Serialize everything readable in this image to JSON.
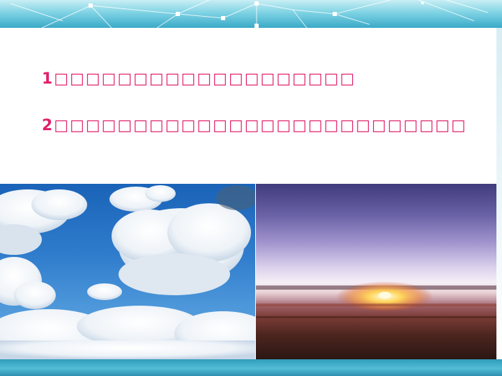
{
  "slide": {
    "lines": [
      {
        "number": "1",
        "text": "□□□□□□□□□□□□□□□□□□□"
      },
      {
        "number": "2",
        "text": "□□□□□□□□□□□□□□□□□□□□□□□□□□"
      }
    ]
  },
  "photos": [
    {
      "subject": "blue-sky-with-white-clouds"
    },
    {
      "subject": "sunrise-above-clouds"
    }
  ],
  "colors": {
    "text_accent": "#e0206b",
    "banner": "#3aaac8"
  }
}
